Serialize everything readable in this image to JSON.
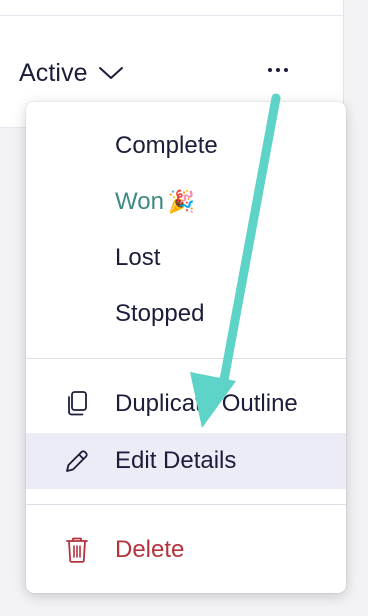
{
  "status": {
    "current": "Active",
    "chevron_icon": "chevron-down-icon",
    "more_icon": "more-horizontal-icon"
  },
  "menu": {
    "status_options": [
      {
        "label": "Complete"
      },
      {
        "label": "Won",
        "icon": "party-popper-icon",
        "emoji": "🎉",
        "color": "#3f8a82"
      },
      {
        "label": "Lost"
      },
      {
        "label": "Stopped"
      }
    ],
    "actions": [
      {
        "label": "Duplicate Outline",
        "icon": "copy-icon"
      },
      {
        "label": "Edit Details",
        "icon": "pencil-icon",
        "highlighted": true
      }
    ],
    "danger": {
      "label": "Delete",
      "icon": "trash-icon",
      "color": "#b5333c"
    }
  },
  "colors": {
    "text": "#1b1d3a",
    "won": "#3f8a82",
    "delete": "#b5333c",
    "highlight_bg": "#ececf6",
    "annotation_arrow": "#5ed3c7"
  },
  "annotation": {
    "type": "arrow",
    "points_to": "Edit Details"
  }
}
